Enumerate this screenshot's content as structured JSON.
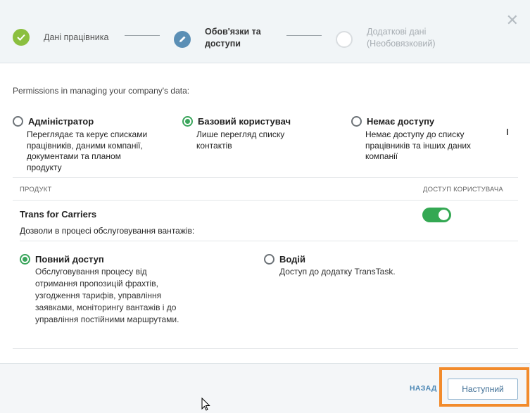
{
  "stepper": {
    "steps": [
      {
        "label_line1": "Дані працівника",
        "label_line2": "",
        "state": "done"
      },
      {
        "label_line1": "Обов'язки та",
        "label_line2": "доступи",
        "state": "active"
      },
      {
        "label_line1": "Додаткові дані",
        "label_line2": "(Необовязковий)",
        "state": "pending"
      }
    ],
    "close_icon": "close-icon"
  },
  "permissions": {
    "title": "Permissions in managing your company's data:",
    "roles": [
      {
        "title": "Адміністратор",
        "desc": [
          "Переглядає та керує списками",
          "працівників, даними компанії,",
          "документами та планом",
          "продукту"
        ],
        "checked": false
      },
      {
        "title": "Базовий користувач",
        "desc": [
          "Лише перегляд списку",
          "контактів"
        ],
        "checked": true
      },
      {
        "title": "Немає доступу",
        "desc": [
          "Немає доступу до списку",
          "працівників та інших даних",
          "компанії"
        ],
        "checked": false
      }
    ]
  },
  "table": {
    "col_product": "ПРОДУКТ",
    "col_access": "ДОСТУП КОРИСТУВАЧА",
    "product_name": "Trans for Carriers",
    "toggle_on": true,
    "perm_label": "Дозволи в процесі обслуговування вантажів:",
    "options": [
      {
        "title": "Повний доступ",
        "desc": [
          "Обслуговування процесу від",
          "отримання пропозицій фрахтів,",
          "узгодження тарифів, управління",
          "заявками, моніторингу вантажів і до",
          "управління постійними маршрутами."
        ],
        "checked": true
      },
      {
        "title": "Водій",
        "desc": [
          "Доступ до додатку TransTask."
        ],
        "checked": false
      }
    ]
  },
  "footer": {
    "back": "НАЗАД",
    "next": "Наступний"
  },
  "colors": {
    "accent_green": "#34a853",
    "step_done": "#8bbf3f",
    "step_active": "#5b8fb5",
    "highlight": "#f28b2c",
    "link": "#4a86b4"
  }
}
